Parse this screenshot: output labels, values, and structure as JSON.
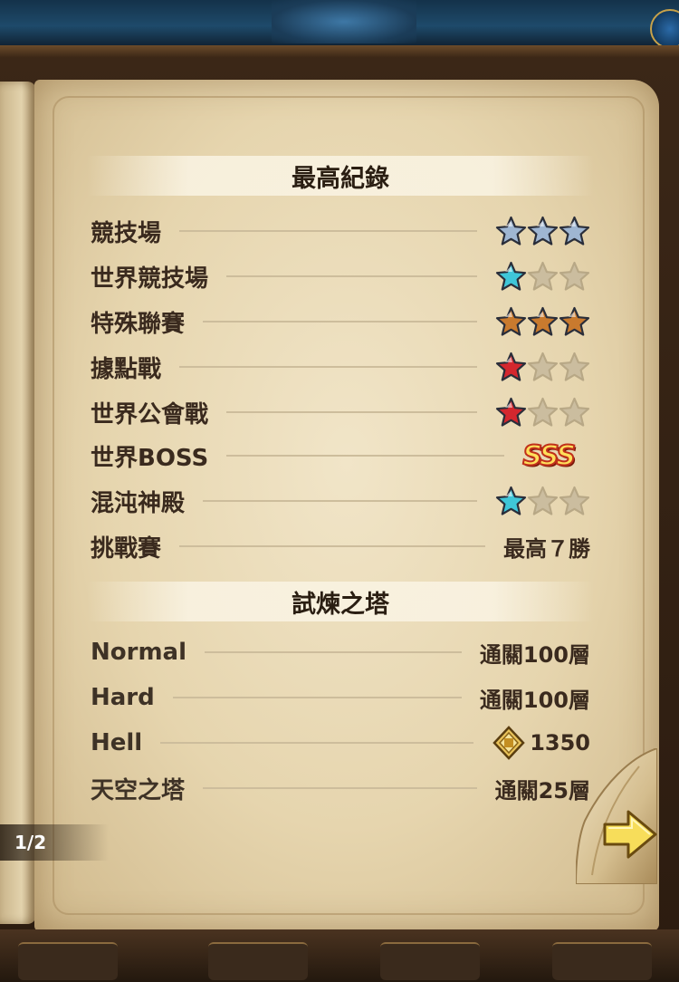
{
  "best_records": {
    "title": "最高紀錄",
    "rows": [
      {
        "label": "競技場",
        "rating": {
          "type": "stars",
          "filled": 3,
          "color": "#9fb6d2"
        }
      },
      {
        "label": "世界競技場",
        "rating": {
          "type": "stars",
          "filled": 1,
          "color": "#3fc6d8"
        }
      },
      {
        "label": "特殊聯賽",
        "rating": {
          "type": "stars",
          "filled": 3,
          "color": "#c97a2e"
        }
      },
      {
        "label": "據點戰",
        "rating": {
          "type": "stars",
          "filled": 1,
          "color": "#d4272e"
        }
      },
      {
        "label": "世界公會戰",
        "rating": {
          "type": "stars",
          "filled": 1,
          "color": "#d4272e"
        }
      },
      {
        "label": "世界BOSS",
        "rating": {
          "type": "grade",
          "text": "SSS"
        }
      },
      {
        "label": "混沌神殿",
        "rating": {
          "type": "stars",
          "filled": 1,
          "color": "#3fc6d8"
        }
      },
      {
        "label": "挑戰賽",
        "rating": {
          "type": "text",
          "text": "最高７勝"
        }
      }
    ]
  },
  "tower_of_trials": {
    "title": "試煉之塔",
    "rows": [
      {
        "label": "Normal",
        "value": "通關100層"
      },
      {
        "label": "Hard",
        "value": "通關100層"
      },
      {
        "label": "Hell",
        "value": "1350",
        "icon": "crest-badge-icon"
      },
      {
        "label": "天空之塔",
        "value": "通關25層"
      }
    ]
  },
  "pagination": {
    "current": "1/2",
    "next_icon": "next-arrow-icon"
  },
  "colors": {
    "empty_star": "#cbbd9f",
    "parchment": "#ecdfbf",
    "text": "#3a2a1e"
  }
}
